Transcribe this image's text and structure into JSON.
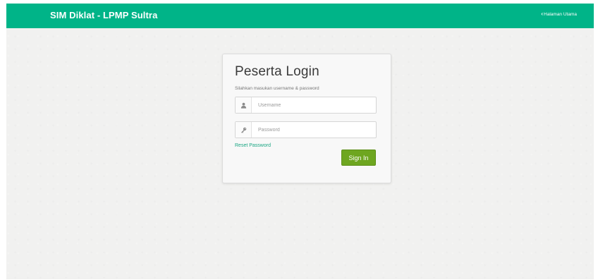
{
  "navbar": {
    "brand": "SIM Diklat - LPMP Sultra",
    "home_link": "Halaman Utama",
    "home_icon": "chevron-left-icon",
    "color": "#00b488"
  },
  "login": {
    "title": "Peserta Login",
    "subtitle": "Silahkan masukan username & password",
    "username": {
      "placeholder": "Username",
      "value": "",
      "icon": "user-icon"
    },
    "password": {
      "placeholder": "Password",
      "value": "",
      "icon": "key-icon"
    },
    "reset_link": "Reset Password",
    "submit_label": "Sign In",
    "submit_color": "#6ea620"
  }
}
